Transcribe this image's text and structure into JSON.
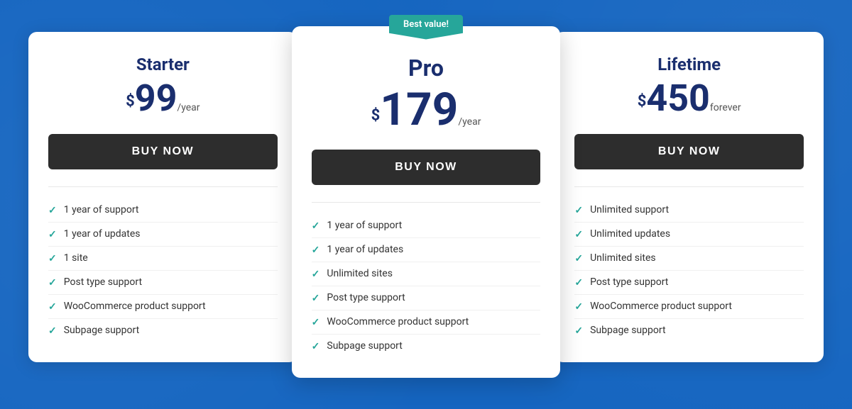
{
  "background": {
    "color": "#1565c0"
  },
  "plans": [
    {
      "id": "starter",
      "name": "Starter",
      "currency": "$",
      "price": "99",
      "period": "/year",
      "badge": null,
      "button_label": "BUY NOW",
      "features": [
        "1 year of support",
        "1 year of updates",
        "1 site",
        "Post type support",
        "WooCommerce product support",
        "Subpage support"
      ]
    },
    {
      "id": "pro",
      "name": "Pro",
      "currency": "$",
      "price": "179",
      "period": "/year",
      "badge": "Best value!",
      "button_label": "BUY NOW",
      "features": [
        "1 year of support",
        "1 year of updates",
        "Unlimited sites",
        "Post type support",
        "WooCommerce product support",
        "Subpage support"
      ]
    },
    {
      "id": "lifetime",
      "name": "Lifetime",
      "currency": "$",
      "price": "450",
      "period": "forever",
      "badge": null,
      "button_label": "BUY NOW",
      "features": [
        "Unlimited support",
        "Unlimited updates",
        "Unlimited sites",
        "Post type support",
        "WooCommerce product support",
        "Subpage support"
      ]
    }
  ]
}
